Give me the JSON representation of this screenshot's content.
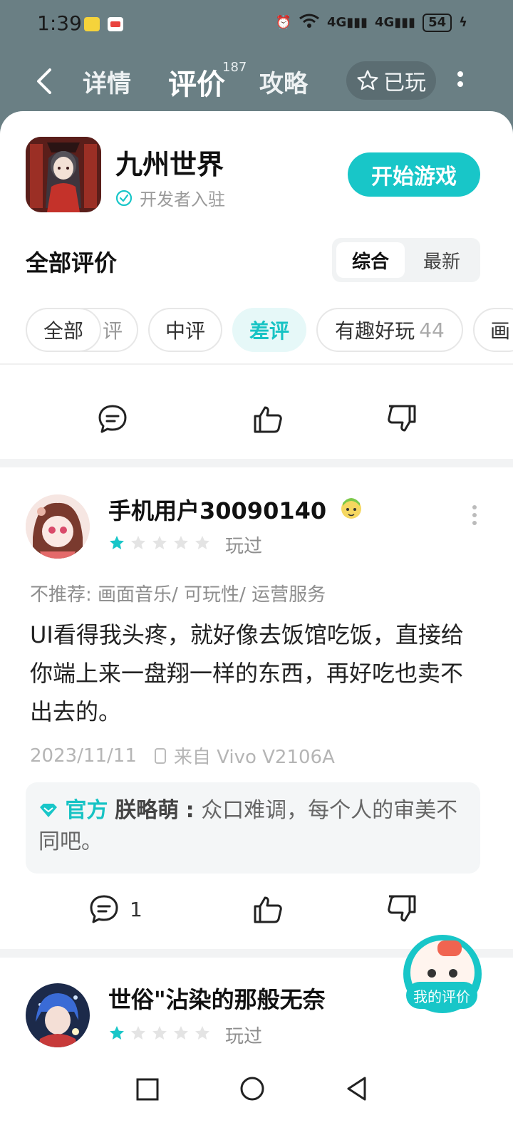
{
  "status_bar": {
    "time": "1:39",
    "network_1": "4G",
    "network_2": "4G",
    "wifi_badge": "6",
    "battery": "54"
  },
  "nav": {
    "tabs": [
      {
        "label": "详情"
      },
      {
        "label": "评价"
      },
      {
        "label": "攻略"
      }
    ],
    "review_count": "187",
    "played_label": "已玩"
  },
  "game": {
    "title": "九州世界",
    "developer_tag": "开发者入驻",
    "start_button": "开始游戏"
  },
  "reviews_header": {
    "title": "全部评价",
    "sort_options": [
      "综合",
      "最新"
    ],
    "sort_selected": "综合"
  },
  "filters": [
    {
      "label": "全部"
    },
    {
      "label": "评"
    },
    {
      "label": "中评"
    },
    {
      "label": "差评"
    },
    {
      "label": "有趣好玩",
      "count": "44"
    },
    {
      "label": "画"
    }
  ],
  "review_1": {
    "user": "手机用户30090140",
    "rating": 1,
    "rating_max": 5,
    "status": "玩过",
    "not_recommend": "不推荐: 画面音乐/ 可玩性/ 运营服务",
    "text": "UI看得我头疼，就好像去饭馆吃饭，直接给你端上来一盘翔一样的东西，再好吃也卖不出去的。",
    "date": "2023/11/11",
    "device": "来自 Vivo V2106A",
    "reply": {
      "badge": "官方",
      "author": "朕略萌",
      "text": "众口难调，每个人的审美不同吧。"
    },
    "comment_count": "1"
  },
  "review_2": {
    "user": "世俗\"沾染的那般无奈",
    "rating": 1,
    "rating_max": 5,
    "status": "玩过"
  },
  "fab": {
    "label": "我的评价"
  },
  "colors": {
    "accent": "#18c6c8",
    "header_bg": "#6a7f84"
  }
}
